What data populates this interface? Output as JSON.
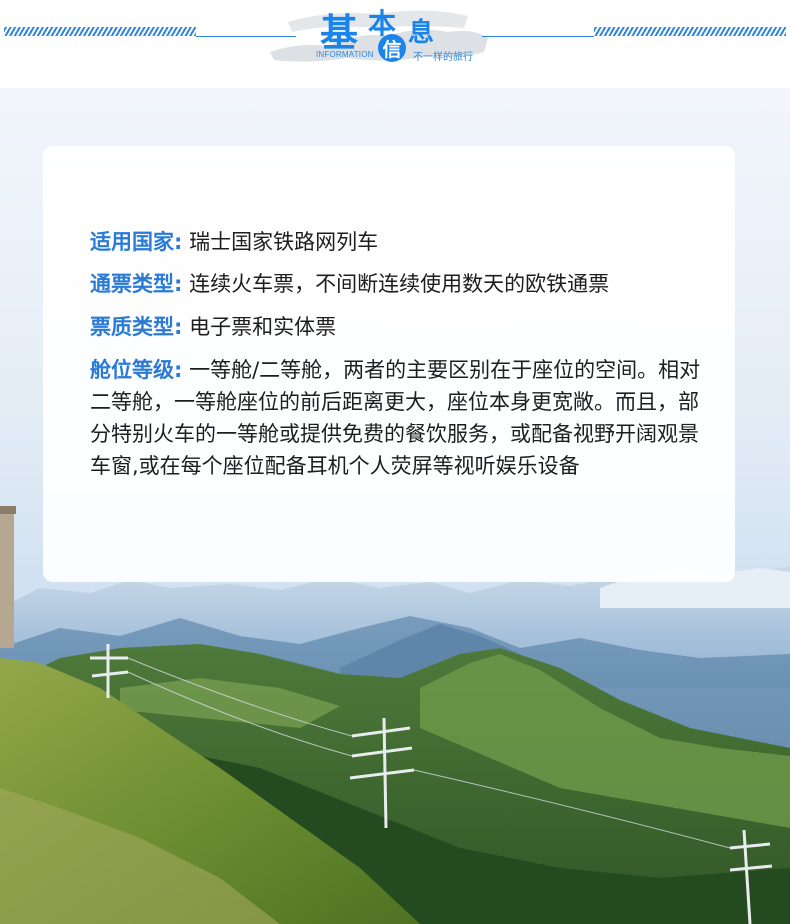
{
  "header": {
    "title_ji": "基",
    "title_ben": "本",
    "title_xin": "信",
    "title_xi": "息",
    "subtitle_en": "INFORMATION",
    "slogan": "不一样的旅行"
  },
  "info": {
    "country_label": "适用国家:",
    "country_value": " 瑞士国家铁路网列车",
    "pass_type_label": "通票类型:",
    "pass_type_value": " 连续火车票，不间断连续使用数天的欧铁通票",
    "ticket_type_label": "票质类型:",
    "ticket_type_value": " 电子票和实体票",
    "class_label": "舱位等级:",
    "class_value": " 一等舱/二等舱，两者的主要区别在于座位的空间。相对二等舱，一等舱座位的前后距离更大，座位本身更宽敞。而且，部分特别火车的一等舱或提供免费的餐饮服务，或配备视野开阔观景车窗,或在每个座位配备耳机个人荧屏等视听娱乐设备"
  },
  "colors": {
    "accent_blue": "#1a84e8",
    "label_blue": "#2a7ad6",
    "card_bg": "#ffffff"
  }
}
